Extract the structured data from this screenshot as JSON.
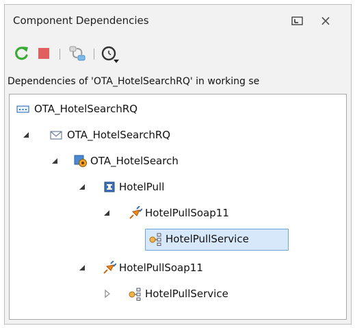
{
  "window": {
    "title": "Component Dependencies",
    "close_glyph": "×"
  },
  "toolbar": {
    "icons": [
      "refresh-icon",
      "stop-icon",
      "link-dependency-icon",
      "history-dropdown-icon"
    ]
  },
  "context_text": "Dependencies of 'OTA_HotelSearchRQ' in working se",
  "tree": {
    "nodes": [
      {
        "label": "OTA_HotelSearchRQ",
        "icon": "element-icon",
        "expanded": null
      },
      {
        "label": "OTA_HotelSearchRQ",
        "icon": "message-icon",
        "expanded": true
      },
      {
        "label": "OTA_HotelSearch",
        "icon": "operation-icon",
        "expanded": true
      },
      {
        "label": "HotelPull",
        "icon": "interface-icon",
        "expanded": true
      },
      {
        "label": "HotelPullSoap11",
        "icon": "binding-icon",
        "expanded": true
      },
      {
        "label": "HotelPullService",
        "icon": "service-icon",
        "expanded": null,
        "selected": true
      },
      {
        "label": "HotelPullSoap11",
        "icon": "binding-icon",
        "expanded": true
      },
      {
        "label": "HotelPullService",
        "icon": "service-icon",
        "expanded": false
      }
    ]
  },
  "colors": {
    "refresh": "#3aaa35",
    "stop": "#e06060",
    "selection_bg": "#d8e8fb",
    "selection_border": "#6fa3dd"
  }
}
